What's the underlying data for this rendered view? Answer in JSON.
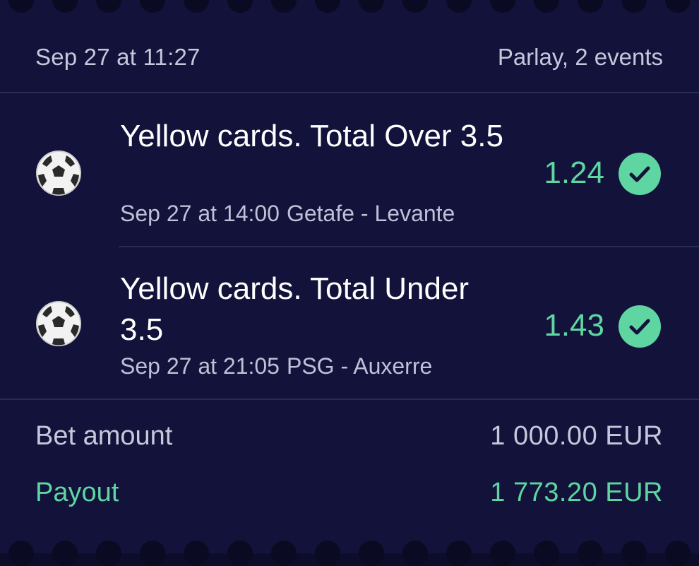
{
  "header": {
    "placed_at": "Sep 27 at 11:27",
    "bet_type": "Parlay, 2 events"
  },
  "events": [
    {
      "icon": "soccer-ball-icon",
      "market": "Yellow cards. Total Over 3.5",
      "start_time": "Sep 27 at 14:00",
      "teams": "Getafe - Levante",
      "odds": "1.24",
      "status": "won"
    },
    {
      "icon": "soccer-ball-icon",
      "market": "Yellow cards. Total Under 3.5",
      "start_time": "Sep 27 at 21:05",
      "teams": "PSG - Auxerre",
      "odds": "1.43",
      "status": "won"
    }
  ],
  "summary": {
    "bet_amount_label": "Bet amount",
    "bet_amount_value": "1 000.00 EUR",
    "payout_label": "Payout",
    "payout_value": "1 773.20 EUR"
  },
  "colors": {
    "background": "#12123a",
    "accent_green": "#5fd6a2",
    "muted_text": "#c7c7dc",
    "divider": "#2a2a58"
  }
}
